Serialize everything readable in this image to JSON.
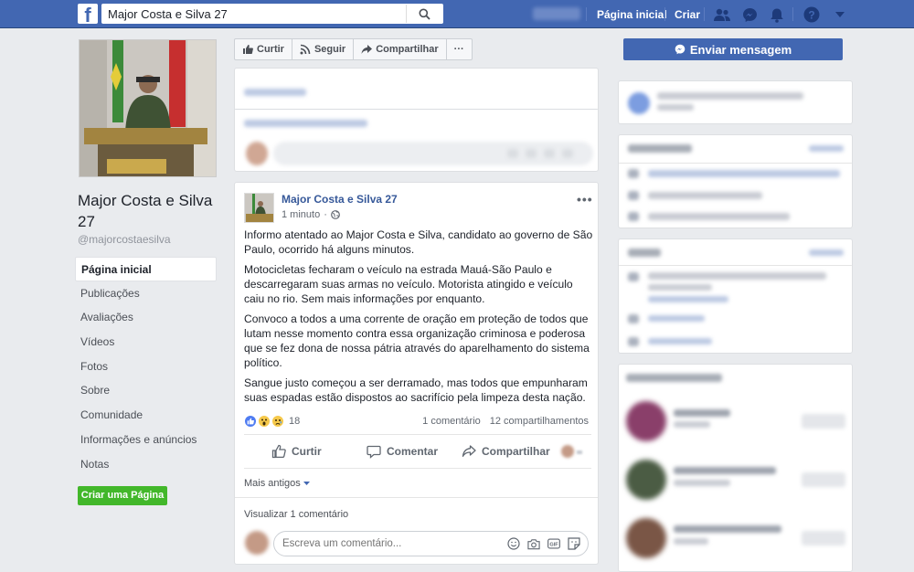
{
  "topbar": {
    "search_value": "Major Costa e Silva 27",
    "home_label": "Página inicial",
    "create_label": "Criar"
  },
  "page": {
    "name": "Major Costa e Silva 27",
    "handle": "@majorcostaesilva"
  },
  "nav": {
    "items": [
      {
        "label": "Página inicial",
        "active": true
      },
      {
        "label": "Publicações"
      },
      {
        "label": "Avaliações"
      },
      {
        "label": "Vídeos"
      },
      {
        "label": "Fotos"
      },
      {
        "label": "Sobre"
      },
      {
        "label": "Comunidade"
      },
      {
        "label": "Informações e anúncios"
      },
      {
        "label": "Notas"
      }
    ],
    "create_page_label": "Criar uma Página"
  },
  "actions": {
    "like": "Curtir",
    "follow": "Seguir",
    "share": "Compartilhar",
    "more": "···",
    "send_message": "Enviar mensagem"
  },
  "post": {
    "author": "Major Costa e Silva 27",
    "time": "1 minuto",
    "paragraphs": [
      "Informo atentado ao Major Costa e Silva, candidato ao governo de São Paulo, ocorrido há alguns minutos.",
      "Motocicletas fecharam o veículo na estrada Mauá-São Paulo e descarregaram suas armas no veículo. Motorista atingido e veículo caiu no rio. Sem mais informações por enquanto.",
      "Convoco a todos a uma corrente de oração em proteção de todos que lutam nesse momento contra essa organização criminosa e poderosa que se fez dona de nossa pátria através do aparelhamento do sistema político.",
      "Sangue justo começou a ser derramado, mas todos que empunharam suas espadas estão dispostos ao sacrifício pela limpeza desta nação."
    ],
    "reaction_count": "18",
    "comments_count": "1 comentário",
    "shares_count": "12 compartilhamentos",
    "like_label": "Curtir",
    "comment_label": "Comentar",
    "share_label": "Compartilhar",
    "more_old": "Mais antigos",
    "view_comments": "Visualizar 1 comentário",
    "comment_placeholder": "Escreva um comentário..."
  },
  "colors": {
    "brand": "#4267b2",
    "link": "#365899",
    "green": "#42b72a",
    "background": "#e9ebee"
  },
  "icons": [
    "facebook-logo-icon",
    "search-icon",
    "friends-icon",
    "messenger-icon",
    "bell-icon",
    "help-icon",
    "caret-down-icon",
    "like-icon",
    "rss-icon",
    "share-icon",
    "globe-icon",
    "comment-icon",
    "emoji-icon",
    "camera-icon",
    "gif-icon",
    "sticker-icon"
  ]
}
